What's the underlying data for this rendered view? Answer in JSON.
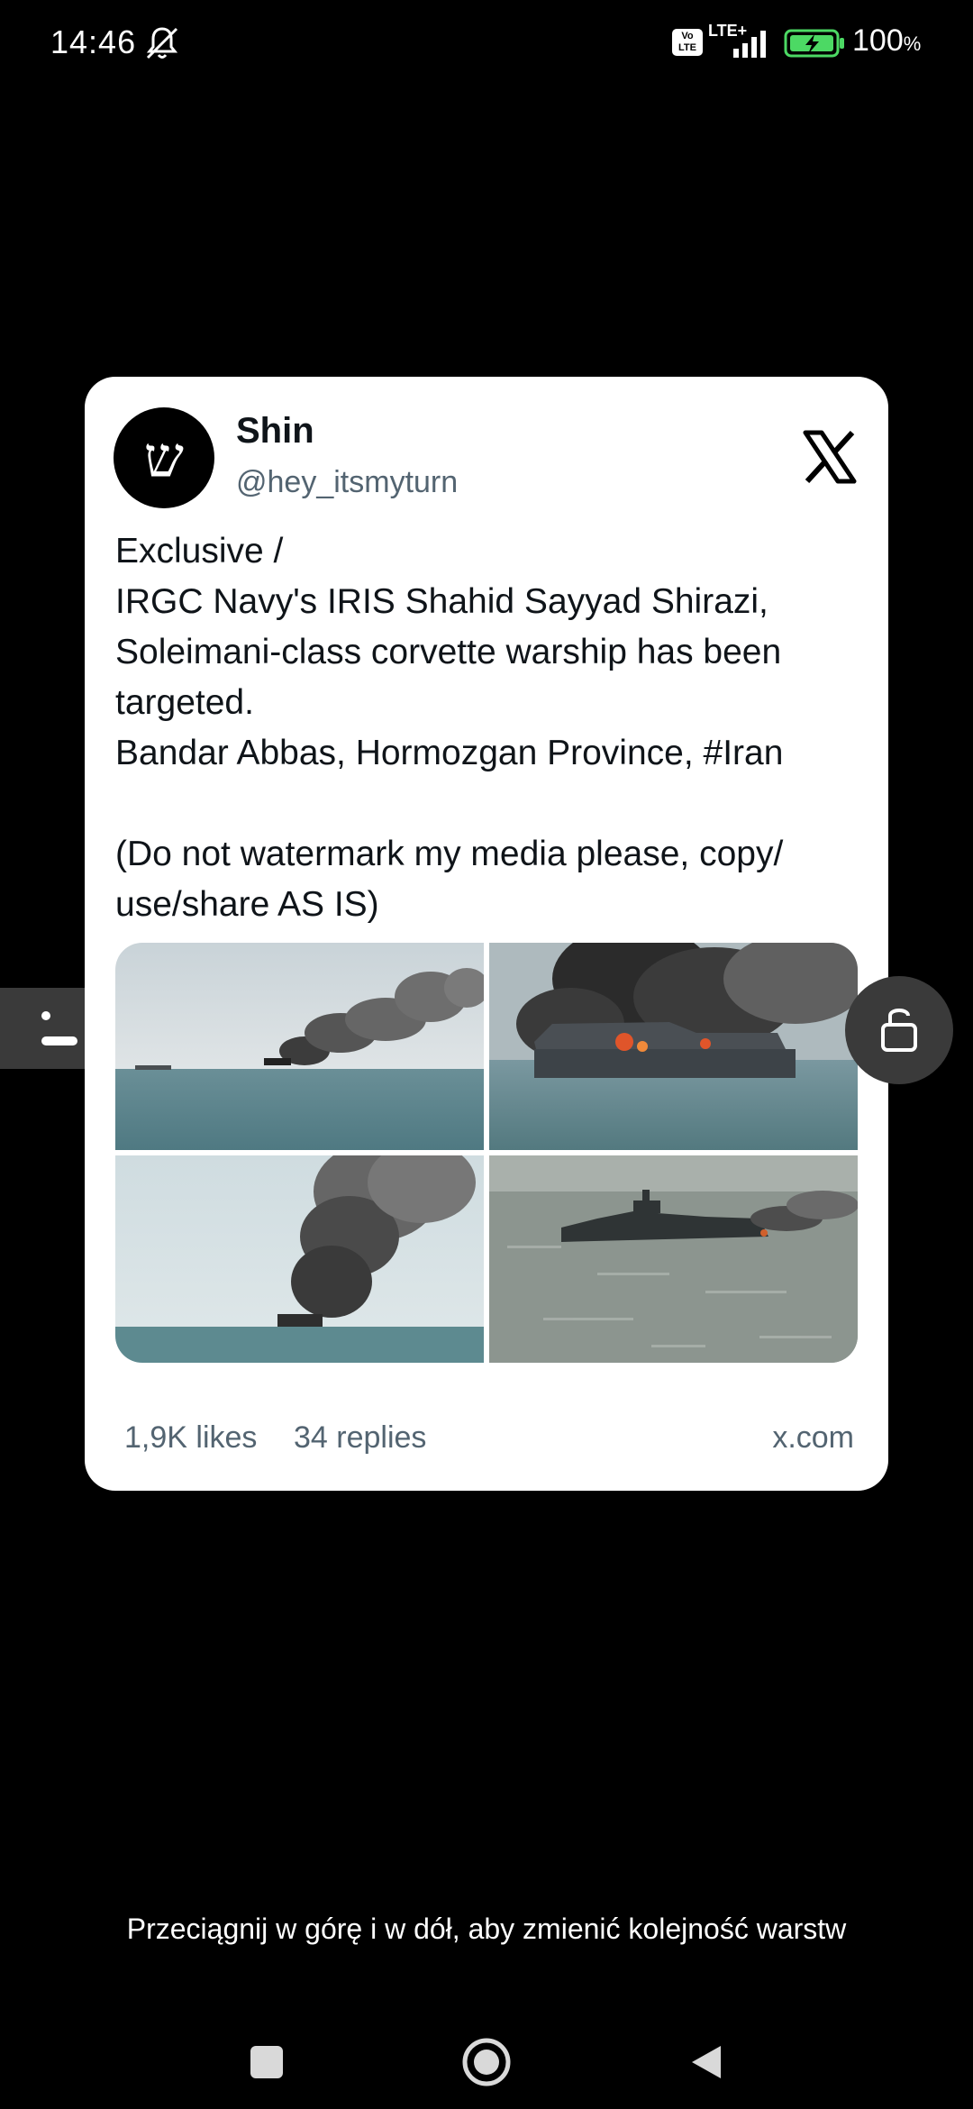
{
  "status_bar": {
    "time": "14:46",
    "volte": "Vo LTE",
    "network": "LTE+",
    "battery": "100",
    "battery_unit": "%"
  },
  "tweet": {
    "author_name": "Shin",
    "author_handle": "@hey_itsmyturn",
    "avatar_glyph": "ש",
    "lines": [
      "Exclusive /",
      "IRGC Navy's IRIS Shahid Sayyad Shirazi,",
      "Soleimani-class corvette warship has been",
      "targeted.",
      "Bandar Abbas, Hormozgan Province, #Iran",
      "",
      "(Do not watermark my media please, copy/",
      "use/share AS IS)"
    ],
    "media_count": 4,
    "likes": "1,9K likes",
    "replies": "34 replies",
    "source": "x.com"
  },
  "hint": "Przeciągnij w górę i w dół, aby zmienić kolejność warstw",
  "colors": {
    "background": "#000000",
    "card": "#ffffff",
    "text_primary": "#0f1419",
    "text_secondary": "#536471",
    "overlay_button": "#3a3a3a",
    "battery_green": "#4cd964"
  },
  "icons": [
    "mute-icon",
    "signal-icon",
    "battery-icon",
    "x-logo-icon",
    "unlock-icon",
    "reorder-handle-icon",
    "recents-icon",
    "home-icon",
    "back-icon"
  ]
}
